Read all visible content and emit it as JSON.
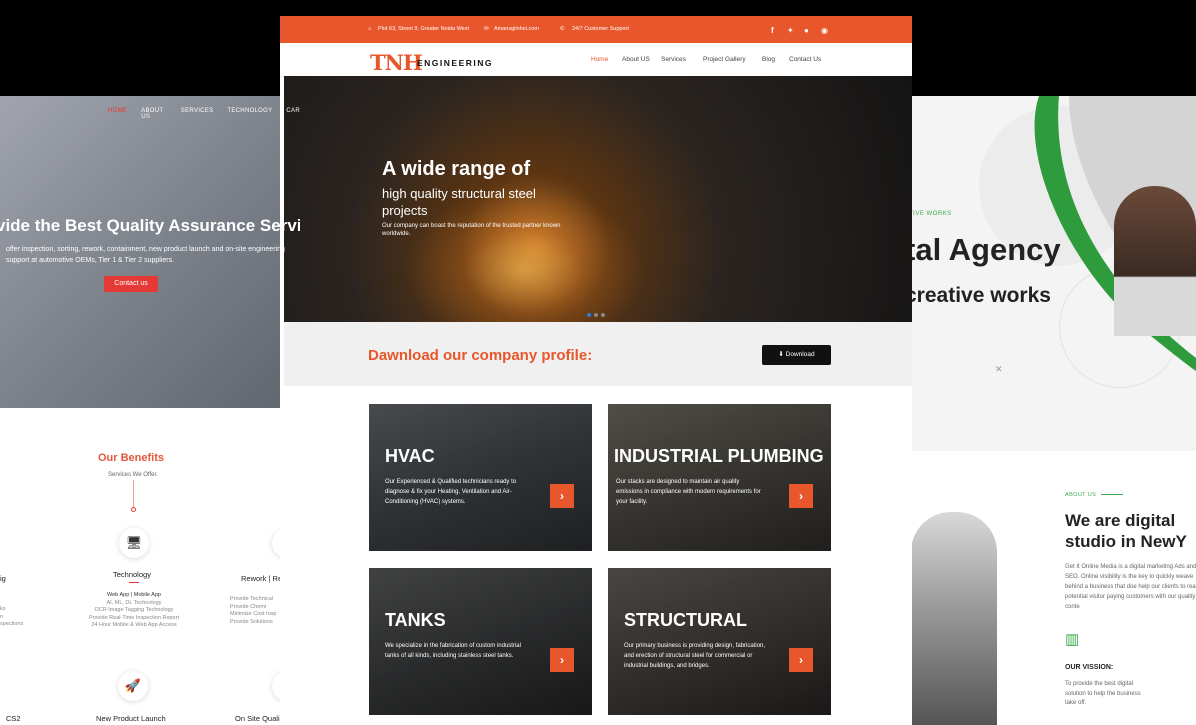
{
  "colors": {
    "accent": "#e8562b",
    "left_accent": "#e53935",
    "right_accent": "#3aa84b"
  },
  "left": {
    "nav": [
      "HOME",
      "ABOUT US",
      "SERVICES",
      "TECHNOLOGY",
      "CAR"
    ],
    "hero_title": "vide the Best Quality Assurance Servi",
    "hero_sub": "offer inspection, sorting, rework, containment, new product launch and on-site engineering support at automotive OEMs, Tier 1 & Tier 2 suppliers.",
    "cta": "Contact us",
    "benefits_title": "Our Benefits",
    "benefits_sub": "Services We Offer.",
    "col1_head": "Technology",
    "col1_items": [
      "Web App | Mobile App",
      "AI, ML, DL Technology",
      "OCR Image Tagging Technology",
      "Provide Real-Time Inspection Report",
      "24 Hour Mobile & Web App Access"
    ],
    "col2_head": "Rework | Re",
    "col2_items": [
      "Provide Technical",
      "Provide Chemi",
      "Minimize Cost Insp",
      "Provide Solutions"
    ],
    "col0_head": "ig",
    "col0_items": [
      "ks",
      "n",
      "spections"
    ],
    "bottom_items": [
      "CS2",
      "New Product Launch",
      "On Site Quali"
    ]
  },
  "center": {
    "topbar": {
      "address": "Plot 63, Street 9, Greater Noida West",
      "email": "Amansgiinhei.com",
      "support": "24/7 Customer Support"
    },
    "logo": "TNH",
    "logo_sub": "ENGINEERING",
    "menu": [
      "Home",
      "About US",
      "Services",
      "Project Gallery",
      "Blog",
      "Contact Us"
    ],
    "hero": {
      "h1": "A wide range of",
      "h2": "high quality structural steel projects",
      "h3": "Our company can boast the reputation of the trusted partner known worldwide."
    },
    "download": {
      "title": "Dawnload our company profile:",
      "button": "Download"
    },
    "cards": [
      {
        "title": "HVAC",
        "text": "Our Experienced & Qualified technicians ready to diagnose & fix your Heating, Ventilation and Air-Conditioning (HVAC) systems."
      },
      {
        "title": "INDUSTRIAL PLUMBING",
        "text": "Our stacks are designed to maintain air quality emissions in compliance with modern requirements for your facility."
      },
      {
        "title": "TANKS",
        "text": "We specialize in the fabrication of custom industrial tanks of all kinds, including stainless steel tanks."
      },
      {
        "title": "STRUCTURAL",
        "text": "Our primary business is providing design, fabrication, and erection of structural steel for commercial or industrial buildings, and bridges."
      }
    ]
  },
  "right": {
    "tag": "TIVE WORKS",
    "h1": "tal Agency",
    "h2": "creative works",
    "about": "ABOUT US",
    "we": "We are digital\nstudio in NewY",
    "para": "Get It Online Media is a digital marketing Ads and SEO. Online visibility is the key to quickly weave behind a business that doe help our clients to reach potential visitor paying customers with our quality conte",
    "vision": "OUR VISSION:",
    "vision_text": "To provide the best digital solution to help the business take off."
  }
}
